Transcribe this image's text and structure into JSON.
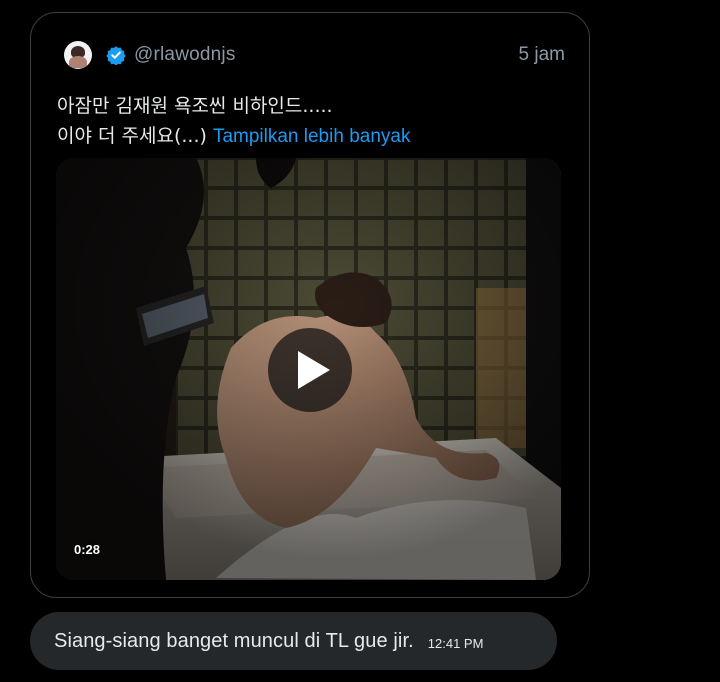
{
  "tweet": {
    "handle": "@rlawodnjs",
    "time": "5 jam",
    "text_line1": "아잠만 김재원 욕조씬 비하인드.....",
    "text_line2": "이야 더 주세요(...)",
    "show_more": "Tampilkan lebih banyak",
    "video": {
      "duration": "0:28"
    },
    "colors": {
      "link": "#1d9bf0",
      "verified": "#1d9bf0"
    },
    "icons": [
      "avatar",
      "verified-badge-icon",
      "play-icon"
    ]
  },
  "reply": {
    "text": "Siang-siang banget muncul di TL gue jir.",
    "time": "12:41 PM"
  }
}
